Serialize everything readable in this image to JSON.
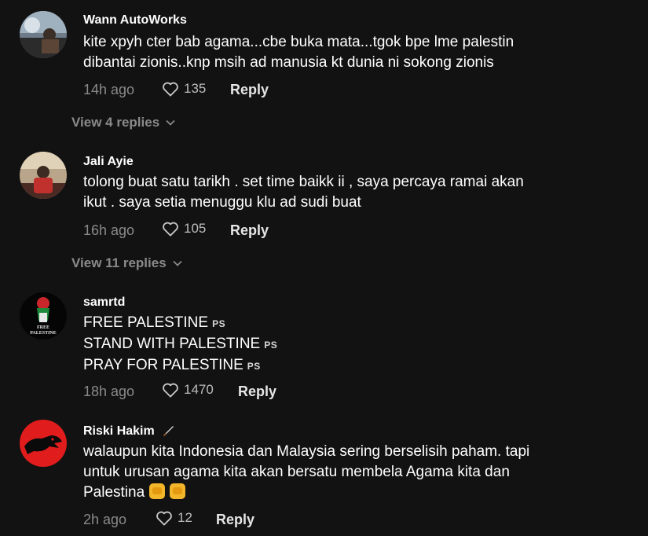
{
  "comments": [
    {
      "username": "Wann AutoWorks",
      "lines": [
        "kite xpyh cter bab agama...cbe buka mata...tgok bpe lme palestin",
        "dibantai zionis..knp msih ad manusia kt dunia ni sokong zionis"
      ],
      "time": "14h ago",
      "likes": "135",
      "reply_label": "Reply",
      "view_replies": "View 4 replies"
    },
    {
      "username": "Jali Ayie",
      "lines": [
        "tolong buat satu tarikh . set time baikk ii , saya percaya ramai akan",
        "ikut . saya setia menuggu klu ad sudi buat"
      ],
      "time": "16h ago",
      "likes": "105",
      "reply_label": "Reply",
      "view_replies": "View 11 replies"
    },
    {
      "username": "samrtd",
      "lines": [
        "FREE PALESTINE",
        "STAND WITH PALESTINE",
        "PRAY FOR PALESTINE"
      ],
      "flag_text": "PS",
      "avatar_text": [
        "FREE",
        "PALESTINE"
      ],
      "time": "18h ago",
      "likes": "1470",
      "reply_label": "Reply"
    },
    {
      "username": "Riski Hakim",
      "lines": [
        "walaupun kita Indonesia dan Malaysia sering berselisih paham. tapi",
        "untuk urusan agama kita akan bersatu membela Agama kita dan",
        "Palestina"
      ],
      "time": "2h ago",
      "likes": "12",
      "reply_label": "Reply"
    }
  ],
  "icons": {
    "like": "heart-outline-icon",
    "expand": "chevron-down-icon",
    "badge": "knife-icon",
    "emoji_1": "raised-fist-icon",
    "emoji_2": "handshake-icon"
  },
  "colors": {
    "background": "#121212",
    "text": "#ffffff",
    "muted": "#8a8a8a"
  }
}
